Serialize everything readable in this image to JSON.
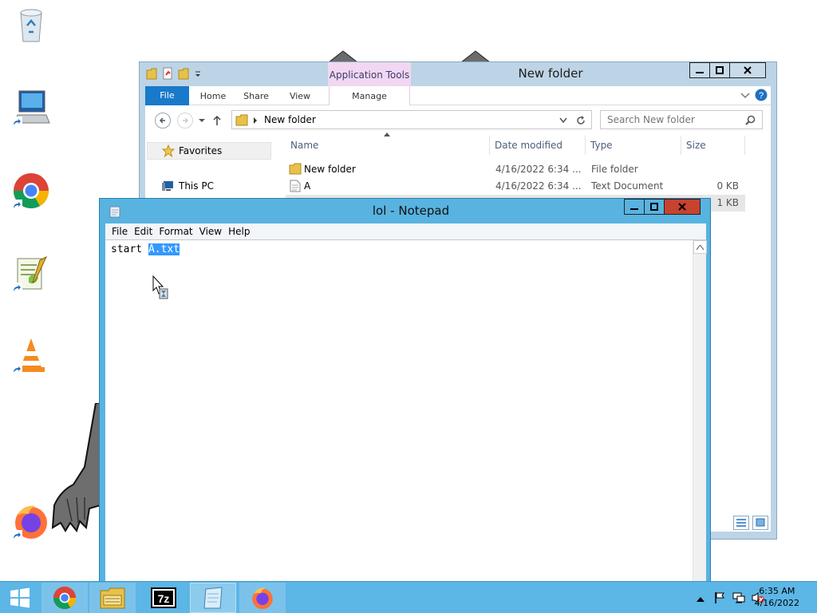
{
  "desktop": {
    "icons": [
      "recycle-bin",
      "computer-shortcut",
      "chrome-shortcut",
      "notepadpp-shortcut",
      "vlc-shortcut",
      "firefox-shortcut"
    ]
  },
  "explorer": {
    "title": "New folder",
    "contextual_tab": "Application Tools",
    "ribbon_tabs": [
      "File",
      "Home",
      "Share",
      "View"
    ],
    "manage_tab": "Manage",
    "address": "New folder",
    "search_placeholder": "Search New folder",
    "nav": {
      "favorites": "Favorites",
      "this_pc": "This PC"
    },
    "columns": [
      "Name",
      "Date modified",
      "Type",
      "Size"
    ],
    "files": [
      {
        "name": "New folder",
        "date": "4/16/2022 6:34 ...",
        "type": "File folder",
        "size": ""
      },
      {
        "name": "A",
        "date": "4/16/2022 6:34 ...",
        "type": "Text Document",
        "size": "0 KB"
      },
      {
        "name": "",
        "date": "",
        "type": "",
        "size": "1 KB"
      }
    ]
  },
  "notepad": {
    "title": "lol - Notepad",
    "menu": [
      "File",
      "Edit",
      "Format",
      "View",
      "Help"
    ],
    "text_before": "start ",
    "text_selected": "A.txt"
  },
  "taskbar": {
    "apps": [
      "start",
      "chrome",
      "file-explorer",
      "7zip",
      "notepad",
      "firefox"
    ],
    "clock_time": "6:35 AM",
    "clock_date": "4/16/2022"
  },
  "colors": {
    "taskbar": "#5cb6e6",
    "notepad_frame": "#58b3e0",
    "file_tab": "#1979ca",
    "close_button": "#c7432f",
    "selection": "#3399ff",
    "contextual_tab": "#f1d7f1"
  }
}
